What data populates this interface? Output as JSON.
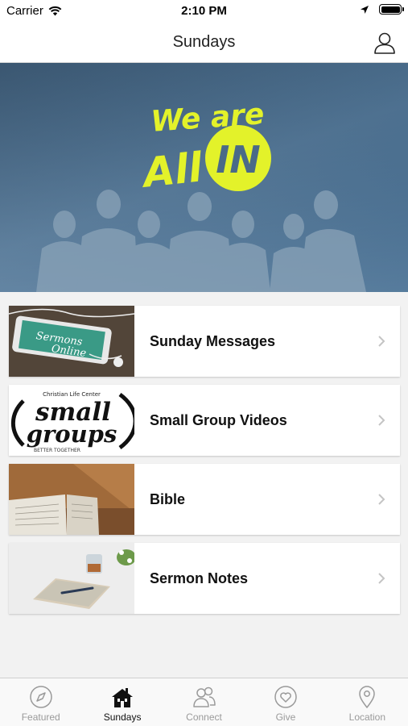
{
  "status_bar": {
    "carrier": "Carrier",
    "time": "2:10 PM"
  },
  "nav": {
    "title": "Sundays"
  },
  "hero": {
    "line1": "We are",
    "line2": "All",
    "line3": "IN"
  },
  "thumbnails": {
    "sermons_line1": "Sermons",
    "sermons_line2": "Online",
    "small_line1": "Christian Life Center",
    "small_line2": "small",
    "small_line3": "groups",
    "small_line4": "BETTER TOGETHER"
  },
  "items": [
    {
      "label": "Sunday Messages"
    },
    {
      "label": "Small Group Videos"
    },
    {
      "label": "Bible"
    },
    {
      "label": "Sermon Notes"
    }
  ],
  "tabs": [
    {
      "label": "Featured",
      "icon": "compass-icon"
    },
    {
      "label": "Sundays",
      "icon": "church-icon"
    },
    {
      "label": "Connect",
      "icon": "people-icon"
    },
    {
      "label": "Give",
      "icon": "heart-icon"
    },
    {
      "label": "Location",
      "icon": "map-pin-icon"
    }
  ],
  "colors": {
    "accent_yellow": "#e3f22a",
    "hero_blue": "#4f7495",
    "active_tab": "#111111",
    "inactive_tab": "#9a9a9a"
  }
}
